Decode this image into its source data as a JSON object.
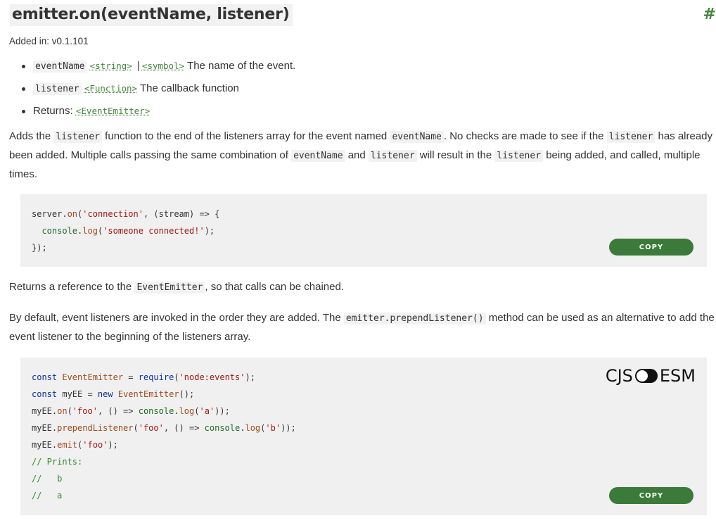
{
  "heading": {
    "title": "emitter.on(eventName, listener)",
    "permalink": "#"
  },
  "added_in": "Added in: v0.1.101",
  "params": [
    {
      "name": "eventName",
      "types": [
        "<string>",
        "<symbol>"
      ],
      "type_sep": "|",
      "desc": "The name of the event."
    },
    {
      "name": "listener",
      "types": [
        "<Function>"
      ],
      "desc": "The callback function"
    },
    {
      "label": "Returns:",
      "types": [
        "<EventEmitter>"
      ]
    }
  ],
  "paragraph1": {
    "t1": "Adds the ",
    "c1": "listener",
    "t2": " function to the end of the listeners array for the event named ",
    "c2": "eventName",
    "t3": ". No checks are made to see if the ",
    "c3": "listener",
    "t4": " has already been added. Multiple calls passing the same combination of ",
    "c4": "eventName",
    "t5": " and ",
    "c5": "listener",
    "t6": " will result in the ",
    "c6": "listener",
    "t7": " being added, and called, multiple times."
  },
  "code1": {
    "lines": [
      "server.on('connection', (stream) => {",
      "  console.log('someone connected!');",
      "});"
    ],
    "copy_label": "COPY"
  },
  "paragraph2": {
    "t1": "Returns a reference to the ",
    "c1": "EventEmitter",
    "t2": ", so that calls can be chained."
  },
  "paragraph3": {
    "t1": "By default, event listeners are invoked in the order they are added. The ",
    "c1": "emitter.prependListener()",
    "t2": " method can be used as an alternative to add the event listener to the beginning of the listeners array."
  },
  "code2": {
    "lines": [
      "const EventEmitter = require('node:events');",
      "const myEE = new EventEmitter();",
      "myEE.on('foo', () => console.log('a'));",
      "myEE.prependListener('foo', () => console.log('b'));",
      "myEE.emit('foo');",
      "// Prints:",
      "//   b",
      "//   a"
    ],
    "copy_label": "COPY",
    "toggle_left": "CJS",
    "toggle_right": "ESM"
  },
  "colors": {
    "accent": "#43853d",
    "button": "#3b7a39",
    "code_bg": "#f0f0f0",
    "text": "#333333"
  }
}
